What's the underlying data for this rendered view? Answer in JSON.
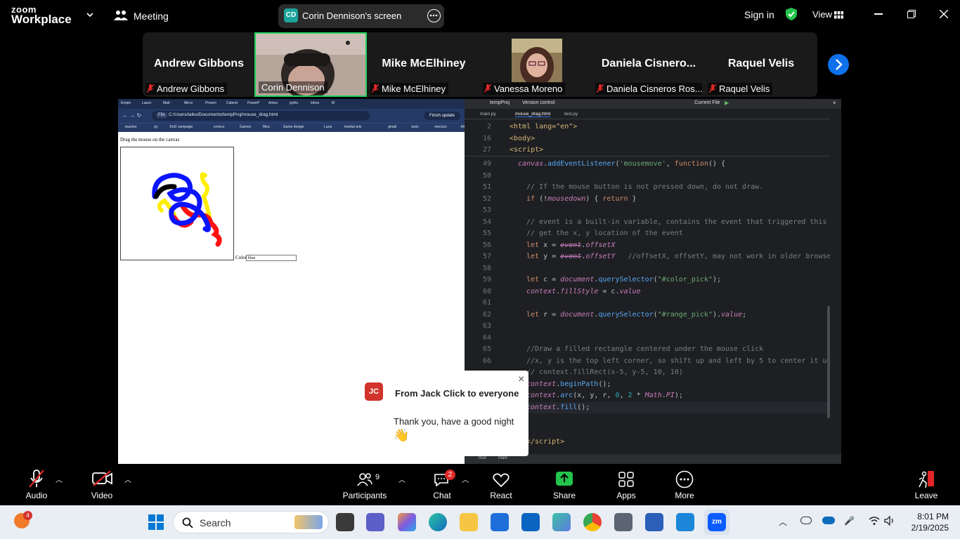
{
  "topbar": {
    "logo_top": "zoom",
    "logo_bottom": "Workplace",
    "meeting_label": "Meeting",
    "share_avatar": "CD",
    "share_title": "Corin Dennison's screen",
    "sign_in": "Sign in",
    "view": "View"
  },
  "participants": [
    {
      "big_name": "Andrew Gibbons",
      "label": "Andrew Gibbons",
      "muted": true
    },
    {
      "big_name": "",
      "label": "Corin Dennison",
      "muted": false,
      "active": true
    },
    {
      "big_name": "Mike McElhiney",
      "label": "Mike McElhiney",
      "muted": true
    },
    {
      "big_name": "",
      "label": "Vanessa Moreno",
      "muted": true
    },
    {
      "big_name": "Daniela  Cisnero...",
      "label": "Daniela Cisneros Ros...",
      "muted": true
    },
    {
      "big_name": "Raquel Velis",
      "label": "Raquel Velis",
      "muted": true
    }
  ],
  "browser": {
    "tabs": [
      "Emplo",
      "Launc",
      "Mail -",
      "Micro",
      "Presen",
      "Calend",
      "PowerP",
      "Amou",
      "pytho",
      "Inbox",
      "M"
    ],
    "address_prefix": "File",
    "address": "C:/Users/taiko/Documents/tempProj/mouse_drag.html",
    "finish_update": "Finish update",
    "bookmarks": [
      "teacher",
      "py",
      "DnD campaign",
      "comics",
      "Games",
      "Misc",
      "Game design",
      "Luna",
      "martial arts",
      "gmail",
      "tools",
      "mocoos",
      "All Bookmarks"
    ],
    "page_heading": "Drag the mouse on the canvas",
    "color_label": "Color",
    "color_value": "blue"
  },
  "ide": {
    "project": "tempProj",
    "vcs": "Version control",
    "run_config": "Current File",
    "tabs": [
      "main.py",
      "mouse_drag.html",
      "test.py"
    ],
    "breadcrumbs": [
      {
        "ln": "2",
        "code": "<html lang=\"en\">"
      },
      {
        "ln": "16",
        "code": "<body>"
      },
      {
        "ln": "27",
        "code": "<script>"
      }
    ],
    "status_left": "Run",
    "status_right": "main"
  },
  "toast": {
    "avatar": "JC",
    "title": "From Jack Click to everyone",
    "message": "Thank you, have a good night",
    "emoji": "👋",
    "close": "×"
  },
  "bottombar": {
    "audio": "Audio",
    "video": "Video",
    "participants": "Participants",
    "participants_count": "9",
    "chat": "Chat",
    "chat_badge": "2",
    "react": "React",
    "share": "Share",
    "apps": "Apps",
    "more": "More",
    "leave": "Leave"
  },
  "taskbar": {
    "widgets_badge": "4",
    "search": "Search",
    "time": "8:01 PM",
    "date": "2/19/2025"
  }
}
